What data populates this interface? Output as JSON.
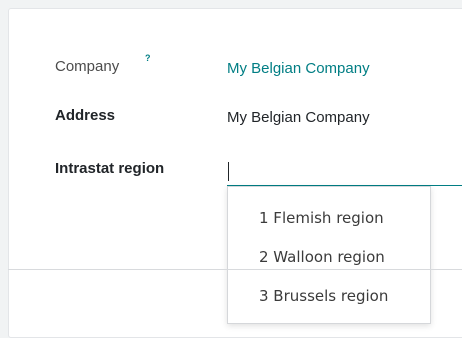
{
  "form": {
    "company_label": "Company",
    "company_help": "?",
    "company_value": "My Belgian Company",
    "address_label": "Address",
    "address_value": "My Belgian Company",
    "intrastat_label": "Intrastat region",
    "intrastat_value": ""
  },
  "dropdown": {
    "options": [
      "1 Flemish region",
      "2 Walloon region",
      "3 Brussels region"
    ]
  },
  "colors": {
    "accent": "#017e84",
    "text": "#212529",
    "muted_label": "#4c4c4c"
  }
}
